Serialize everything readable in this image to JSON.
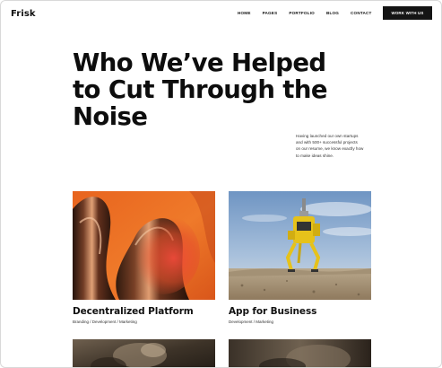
{
  "header": {
    "logo": "Frisk",
    "nav": [
      {
        "label": "HOME"
      },
      {
        "label": "PAGES"
      },
      {
        "label": "PORTFOLIO"
      },
      {
        "label": "BLOG"
      },
      {
        "label": "CONTACT"
      }
    ],
    "cta_label": "WORK WITH US"
  },
  "hero": {
    "title_lines": [
      "Who We’ve Helped",
      "to Cut Through the",
      "Noise"
    ],
    "description_lines": [
      "Having launched our own startups",
      "and with 500+ successful projects",
      "on our resume, we know exactly how",
      "to make ideas shine."
    ]
  },
  "portfolio": [
    {
      "title": "Decentralized Platform",
      "tags": "Branding / Development / Marketing",
      "image": "abstract-orange-chrome-render"
    },
    {
      "title": "App for Business",
      "tags": "Development / Marketing",
      "image": "yellow-robot-desert"
    },
    {
      "title": "",
      "tags": "",
      "image": "dark-texture-partial"
    },
    {
      "title": "",
      "tags": "",
      "image": "dark-scene-partial"
    }
  ],
  "colors": {
    "text": "#111111",
    "cta_bg": "#141414",
    "cta_text": "#ffffff",
    "accent_orange": "#e8641e"
  }
}
